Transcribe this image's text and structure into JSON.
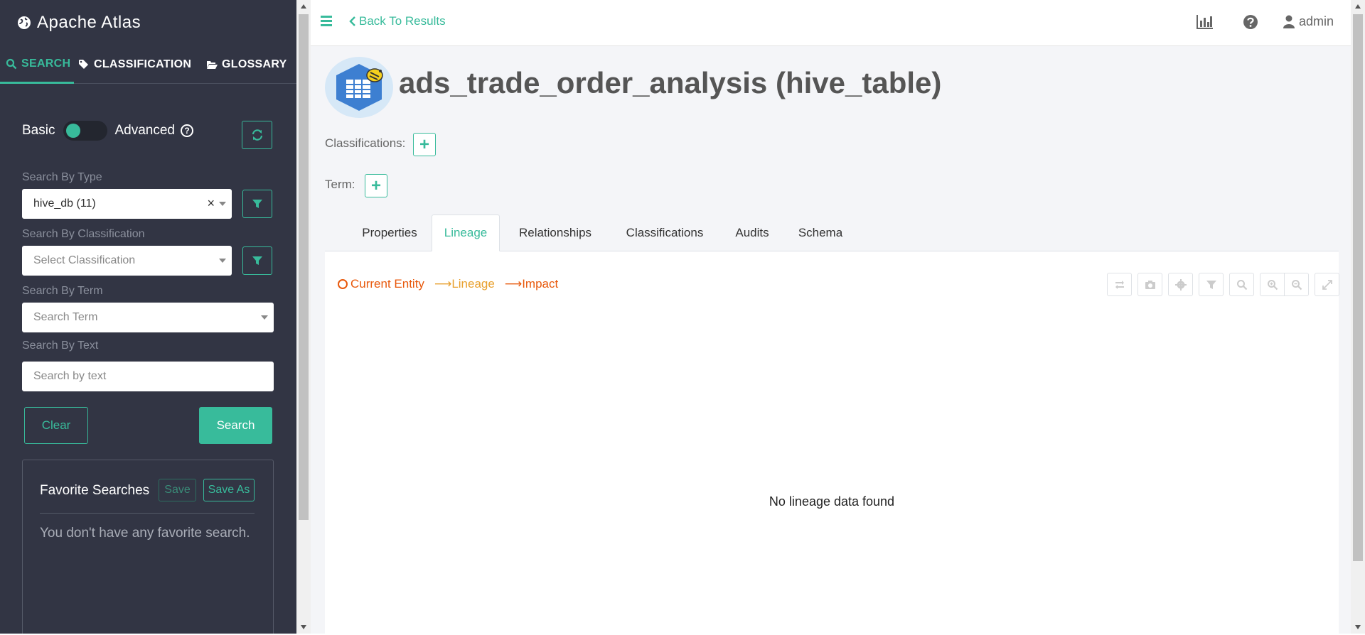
{
  "app": {
    "title": "Apache Atlas"
  },
  "sidebar": {
    "tabs": [
      {
        "label": "SEARCH",
        "icon": "search-icon"
      },
      {
        "label": "CLASSIFICATION",
        "icon": "tag-icon"
      },
      {
        "label": "GLOSSARY",
        "icon": "folder-open-icon"
      }
    ],
    "toggle": {
      "left": "Basic",
      "right": "Advanced"
    },
    "type": {
      "label": "Search By Type",
      "value": "hive_db (11)"
    },
    "classification": {
      "label": "Search By Classification",
      "placeholder": "Select Classification"
    },
    "term": {
      "label": "Search By Term",
      "placeholder": "Search Term"
    },
    "text": {
      "label": "Search By Text",
      "placeholder": "Search by text"
    },
    "buttons": {
      "clear": "Clear",
      "search": "Search"
    },
    "favorites": {
      "title": "Favorite Searches",
      "save": "Save",
      "save_as": "Save As",
      "empty": "You don't have any favorite search."
    }
  },
  "topbar": {
    "back": "Back To Results",
    "user": "admin"
  },
  "entity": {
    "title": "ads_trade_order_analysis (hive_table)",
    "classifications_label": "Classifications:",
    "term_label": "Term:"
  },
  "tabs": [
    {
      "label": "Properties"
    },
    {
      "label": "Lineage"
    },
    {
      "label": "Relationships"
    },
    {
      "label": "Classifications"
    },
    {
      "label": "Audits"
    },
    {
      "label": "Schema"
    }
  ],
  "lineage": {
    "legend": {
      "current": "Current Entity",
      "lineage": "Lineage",
      "impact": "Impact"
    },
    "empty": "No lineage data found"
  },
  "colors": {
    "accent": "#38bb9b",
    "sidebar": "#323544",
    "impact": "#e8590c",
    "lineage": "#e8a02e"
  }
}
